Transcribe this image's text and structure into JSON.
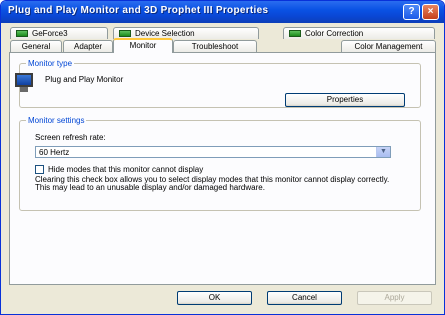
{
  "window": {
    "title": "Plug and Play Monitor and 3D Prophet III Properties",
    "help_glyph": "?",
    "close_glyph": "×"
  },
  "tabs": {
    "row_back": [
      {
        "label": "GeForce3",
        "icon": "nvidia-icon"
      },
      {
        "label": "Device Selection",
        "icon": "nvidia-icon"
      },
      {
        "label": "Color Correction",
        "icon": "nvidia-icon"
      }
    ],
    "row_front": [
      {
        "label": "General"
      },
      {
        "label": "Adapter"
      },
      {
        "label": "Monitor",
        "selected": true
      },
      {
        "label": "Troubleshoot"
      },
      {
        "label": "Color Management"
      }
    ]
  },
  "monitor_type": {
    "legend": "Monitor type",
    "name": "Plug and Play Monitor",
    "properties_button": "Properties"
  },
  "monitor_settings": {
    "legend": "Monitor settings",
    "refresh_label": "Screen refresh rate:",
    "refresh_value": "60 Hertz",
    "hide_modes_label": "Hide modes that this monitor cannot display",
    "hide_modes_checked": false,
    "description": "Clearing this check box allows you to select display modes that this monitor cannot display correctly. This may lead to an unusable display and/or damaged hardware."
  },
  "footer": {
    "ok": "OK",
    "cancel": "Cancel",
    "apply": "Apply"
  },
  "colors": {
    "titlebar": "#0a52e4",
    "group_legend": "#0046d5",
    "selected_tab_accent": "#ffc83c",
    "dialog_bg": "#ece9d8"
  }
}
